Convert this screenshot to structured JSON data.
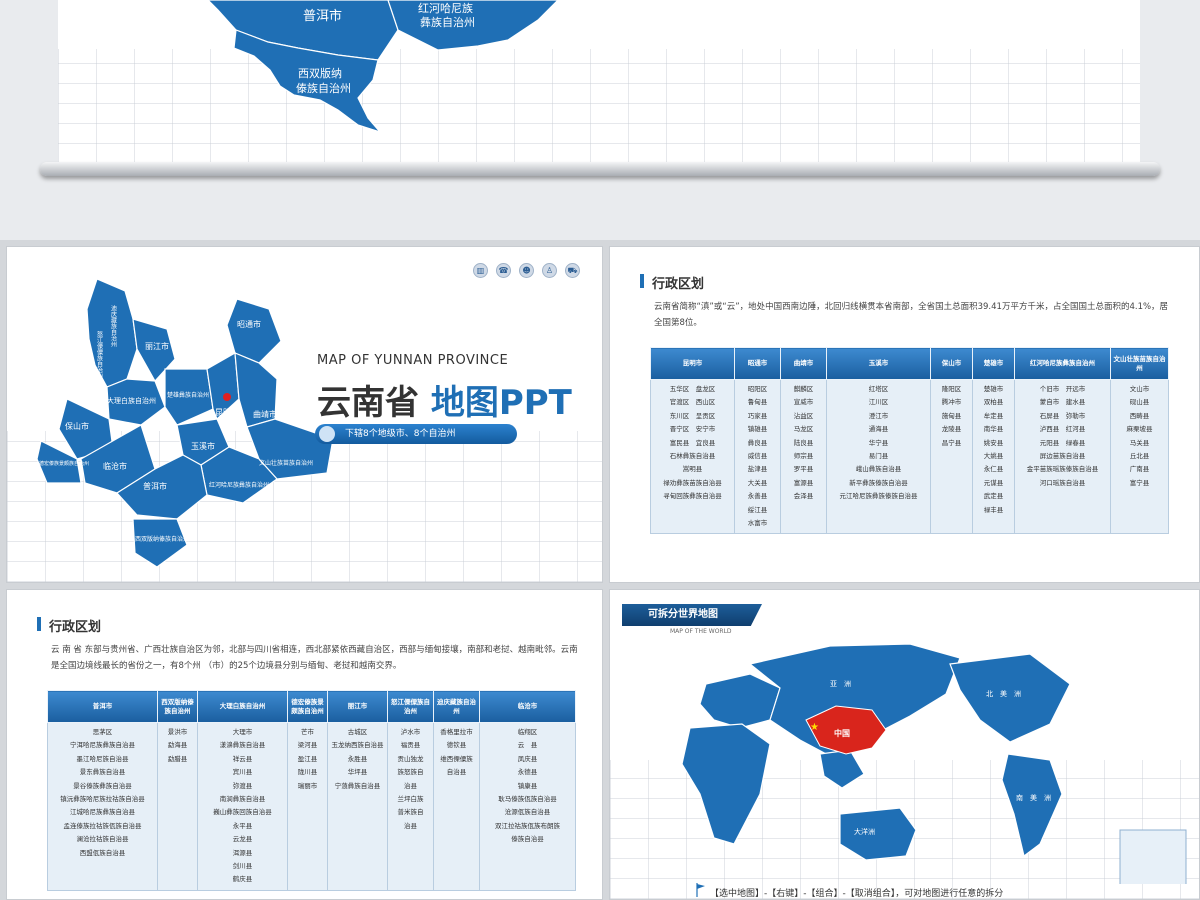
{
  "hero": {
    "labels": [
      "普洱市",
      "红河哈尼族",
      "彝族自治州",
      "西双版纳",
      "傣族自治州"
    ]
  },
  "slide2": {
    "eng_title": "MAP OF YUNNAN PROVINCE",
    "title_a": "云南省",
    "title_b": "地图PPT",
    "subtitle": "下辖8个地级市、8个自治州",
    "map_labels": [
      "迪庆藏族自治州",
      "丽江市",
      "昭通市",
      "怒江傈僳族自治州",
      "大理白族自治州",
      "楚雄彝族自治州",
      "昆明市",
      "曲靖市",
      "保山市",
      "德宏傣族景颇族自治州",
      "玉溪市",
      "临沧市",
      "文山壮族苗族自治州",
      "红河哈尼族彝族自治州",
      "普洱市",
      "西双版纳傣族自治州"
    ],
    "tools": [
      "chart-icon",
      "phone-icon",
      "people-icon",
      "person-icon",
      "cart-icon"
    ],
    "accent": "#1f6fb5"
  },
  "slide3": {
    "section_title": "行政区划",
    "intro": "云南省简称“滇”或“云”，地处中国西南边陲，北回归线横贯本省南部，全省国土总面积39.41万平方千米，占全国国土总面积的4.1%，居全国第8位。",
    "columns": [
      {
        "header": "昆明市",
        "items": [
          "五华区　盘龙区",
          "官渡区　西山区",
          "东川区　呈贡区",
          "晋宁区　安宁市",
          "富民县　宜良县",
          "石林彝族自治县",
          "嵩明县",
          "禄劝彝族苗族自治县",
          "寻甸回族彝族自治县"
        ]
      },
      {
        "header": "昭通市",
        "items": [
          "昭阳区",
          "鲁甸县",
          "巧家县",
          "镇雄县",
          "彝良县",
          "威信县",
          "盐津县",
          "大关县",
          "永善县",
          "绥江县",
          "水富市"
        ]
      },
      {
        "header": "曲靖市",
        "items": [
          "麒麟区",
          "宣威市",
          "沾益区",
          "马龙区",
          "陆良县",
          "师宗县",
          "罗平县",
          "富源县",
          "会泽县"
        ]
      },
      {
        "header": "玉溪市",
        "items": [
          "红塔区",
          "江川区",
          "澄江市",
          "通海县",
          "华宁县",
          "易门县",
          "峨山彝族自治县",
          "新平彝族傣族自治县",
          "元江哈尼族彝族傣族自治县"
        ]
      },
      {
        "header": "保山市",
        "items": [
          "隆阳区",
          "腾冲市",
          "施甸县",
          "龙陵县",
          "昌宁县"
        ]
      },
      {
        "header": "楚雄市",
        "items": [
          "楚雄市",
          "双柏县",
          "牟定县",
          "南华县",
          "姚安县",
          "大姚县",
          "永仁县",
          "元谋县",
          "武定县",
          "禄丰县"
        ]
      },
      {
        "header": "红河哈尼族彝族自治州",
        "items": [
          "个旧市　开远市",
          "蒙自市　建水县",
          "石屏县　弥勒市",
          "泸西县　红河县",
          "元阳县　绿春县",
          "屏边苗族自治县",
          "金平苗族瑶族傣族自治县",
          "河口瑶族自治县"
        ]
      },
      {
        "header": "文山壮族苗族自治州",
        "items": [
          "文山市",
          "砚山县",
          "西畴县",
          "麻栗坡县",
          "马关县",
          "丘北县",
          "广南县",
          "富宁县"
        ]
      }
    ]
  },
  "slide4": {
    "section_title": "行政区划",
    "intro": "云 南 省 东部与贵州省、广西壮族自治区为邻，北部与四川省相连，西北部紧依西藏自治区，西部与缅甸接壤，南部和老挝、越南毗邻。云南是全国边境线最长的省份之一，有8个州 （市）的25个边境县分别与缅甸、老挝和越南交界。",
    "columns": [
      {
        "header": "普洱市",
        "items": [
          "思茅区",
          "宁洱哈尼族彝族自治县",
          "墨江哈尼族自治县",
          "景东彝族自治县",
          "景谷傣族彝族自治县",
          "镇沅彝族哈尼族拉祜族自治县",
          "江城哈尼族彝族自治县",
          "孟连傣族拉祜族佤族自治县",
          "澜沧拉祜族自治县",
          "西盟佤族自治县"
        ]
      },
      {
        "header": "西双版纳傣族自治州",
        "items": [
          "景洪市",
          "勐海县",
          "勐腊县"
        ]
      },
      {
        "header": "大理白族自治州",
        "items": [
          "大理市",
          "漾濞彝族自治县",
          "祥云县",
          "宾川县",
          "弥渡县",
          "南涧彝族自治县",
          "巍山彝族回族自治县",
          "永平县",
          "云龙县",
          "洱源县",
          "剑川县",
          "鹤庆县"
        ]
      },
      {
        "header": "德宏傣族景颇族自治州",
        "items": [
          "芒市",
          "梁河县",
          "盈江县",
          "陇川县",
          "瑞丽市"
        ]
      },
      {
        "header": "丽江市",
        "items": [
          "古城区",
          "玉龙纳西族自治县",
          "永胜县",
          "华坪县",
          "宁蒗彝族自治县"
        ]
      },
      {
        "header": "怒江傈僳族自治州",
        "items": [
          "泸水市",
          "福贡县",
          "贡山独龙",
          "族怒族自",
          "治县",
          "兰坪白族",
          "普米族自",
          "治县"
        ]
      },
      {
        "header": "迪庆藏族自治州",
        "items": [
          "香格里拉市",
          "德钦县",
          "维西傈僳族",
          "自治县"
        ]
      },
      {
        "header": "临沧市",
        "items": [
          "临翔区",
          "云　县",
          "凤庆县",
          "永德县",
          "镇康县",
          "耿马傣族佤族自治县",
          "沧源佤族自治县",
          "双江拉祜族佤族布朗族",
          "傣族自治县"
        ]
      }
    ]
  },
  "slide5": {
    "banner": "可拆分世界地图",
    "banner_sub": "MAP OF THE WORLD",
    "china_label": "中国",
    "labels": [
      "亚　洲",
      "北　美　洲",
      "大洋洲",
      "南　美　洲"
    ],
    "footnote": "【选中地图】-【右键】-【组合】-【取消组合】，可对地图进行任意的拆分",
    "china_color": "#d9251c"
  }
}
